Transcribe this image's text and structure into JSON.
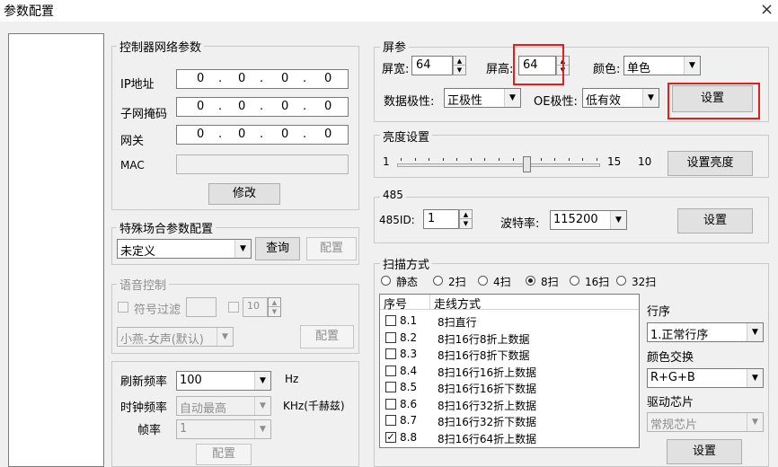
{
  "window": {
    "title": "参数配置",
    "close_symbol": "×"
  },
  "network": {
    "group_title": "控制器网络参数",
    "ip_label": "IP地址",
    "ip_octets": [
      "0",
      "0",
      "0",
      "0"
    ],
    "mask_label": "子网掩码",
    "mask_octets": [
      "0",
      "0",
      "0",
      "0"
    ],
    "gateway_label": "网关",
    "gateway_octets": [
      "0",
      "0",
      "0",
      "0"
    ],
    "mac_label": "MAC",
    "mac_value": "",
    "modify_button": "修改"
  },
  "special": {
    "group_title": "特殊场合参数配置",
    "selected": "未定义",
    "query_button": "查询",
    "config_button": "配置"
  },
  "voice": {
    "group_title": "语音控制",
    "filter_label": "符号过滤",
    "filter_value": "",
    "number_value": "10",
    "voice_selected": "小燕-女声(默认)",
    "config_button": "配置"
  },
  "frequency": {
    "refresh_label": "刷新频率",
    "refresh_value": "100",
    "refresh_unit": "Hz",
    "clock_label": "时钟频率",
    "clock_value": "自动最高",
    "clock_unit": "KHz(千赫兹)",
    "frame_label": "帧率",
    "frame_value": "1",
    "config_button": "配置"
  },
  "screen": {
    "group_title": "屏参",
    "width_label": "屏宽:",
    "width_value": "64",
    "height_label": "屏高:",
    "height_value": "64",
    "color_label": "颜色:",
    "color_value": "单色",
    "data_polarity_label": "数据极性:",
    "data_polarity_value": "正极性",
    "oe_label": "OE极性:",
    "oe_value": "低有效",
    "set_button": "设置"
  },
  "brightness": {
    "group_title": "亮度设置",
    "min": "1",
    "max": "15",
    "level": 10,
    "current_value": "10",
    "set_button": "设置亮度"
  },
  "rs485": {
    "group_title": "485",
    "id_label": "485ID:",
    "id_value": "1",
    "baud_label": "波特率:",
    "baud_value": "115200",
    "set_button": "设置"
  },
  "scan": {
    "group_title": "扫描方式",
    "modes": [
      "静态",
      "2扫",
      "4扫",
      "8扫",
      "16扫",
      "32扫"
    ],
    "selected_mode": "8扫",
    "col_no": "序号",
    "col_method": "走线方式",
    "rows": [
      {
        "no": "8.1",
        "desc": "8扫直行",
        "checked": false
      },
      {
        "no": "8.2",
        "desc": "8扫16行8折上数据",
        "checked": false
      },
      {
        "no": "8.3",
        "desc": "8扫16行8折下数据",
        "checked": false
      },
      {
        "no": "8.4",
        "desc": "8扫16行16折上数据",
        "checked": false
      },
      {
        "no": "8.5",
        "desc": "8扫16行16折下数据",
        "checked": false
      },
      {
        "no": "8.6",
        "desc": "8扫16行32折上数据",
        "checked": false
      },
      {
        "no": "8.7",
        "desc": "8扫16行32折下数据",
        "checked": false
      },
      {
        "no": "8.8",
        "desc": "8扫16行64折上数据",
        "checked": true
      }
    ],
    "row_order_label": "行序",
    "row_order_value": "1.正常行序",
    "color_swap_label": "颜色交换",
    "color_swap_value": "R+G+B",
    "driver_label": "驱动芯片",
    "driver_value": "常规芯片",
    "set_button": "设置"
  }
}
